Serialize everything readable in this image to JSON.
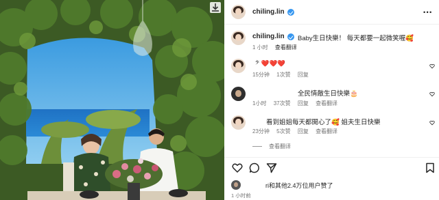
{
  "post": {
    "author": "chiling.lin",
    "caption_user": "chiling.lin",
    "caption_text": "Baby生日快樂！ 每天都要一起微笑喔🥰",
    "caption_time": "1 小时",
    "caption_translate": "查看翻译"
  },
  "comments": [
    {
      "user": "",
      "text": "𝄢 ❤️❤️❤️",
      "time": "15分钟",
      "likes": "1次赞",
      "reply": "回复"
    },
    {
      "user": "",
      "text": "全民情敵生日快樂🎂",
      "time": "1小时",
      "likes": "37次赞",
      "reply": "回复",
      "translate": "查看翻译"
    },
    {
      "user": "",
      "text": "看到姐姐每天都開心了🥰 姐夫生日快樂",
      "time": "23分钟",
      "likes": "5次赞",
      "reply": "回复",
      "translate": "查看翻译"
    }
  ],
  "more_replies": "查看翻译",
  "likes_summary": "ri和其他2.4万位用户赞了",
  "post_time": "1 小时前",
  "icons": {
    "like": "heart-icon",
    "comment": "comment-icon",
    "share": "share-icon",
    "save": "bookmark-icon",
    "more": "more-icon",
    "download": "download-icon"
  },
  "colors": {
    "verified": "#3797f0",
    "heart_red": "#ed4956",
    "meta_gray": "#737373"
  }
}
